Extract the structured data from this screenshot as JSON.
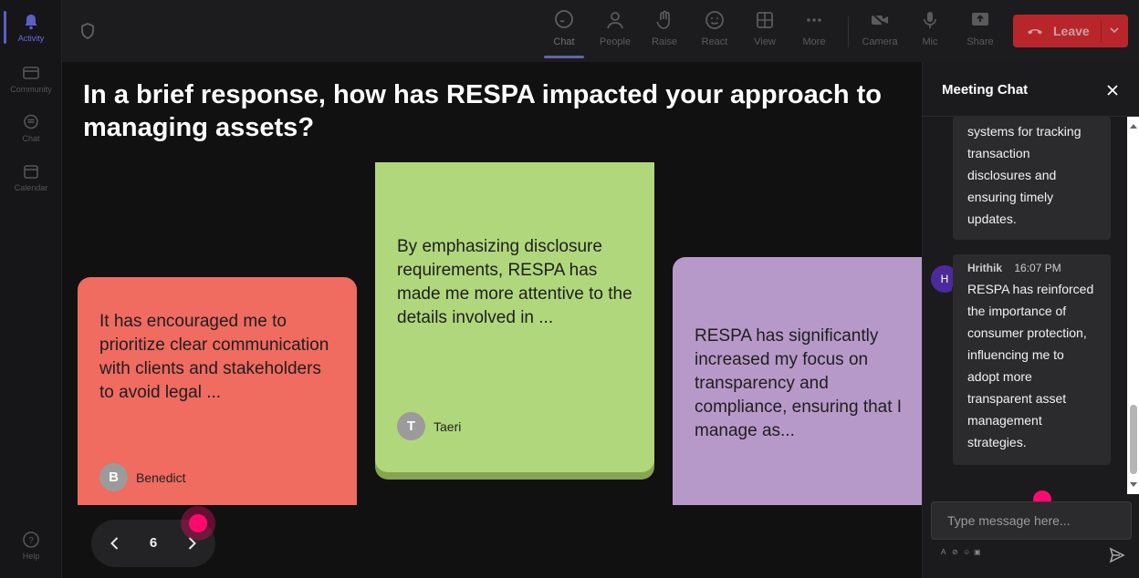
{
  "rail": {
    "items": [
      {
        "label": "Activity",
        "icon": "bell-icon",
        "active": true
      },
      {
        "label": "Community",
        "icon": "community-icon",
        "active": false
      },
      {
        "label": "Chat",
        "icon": "chat-icon",
        "active": false
      },
      {
        "label": "Calendar",
        "icon": "calendar-icon",
        "active": false
      }
    ],
    "help_label": "Help"
  },
  "toolbar": {
    "chat_label": "Chat",
    "people_label": "People",
    "raise_label": "Raise",
    "react_label": "React",
    "view_label": "View",
    "more_label": "More",
    "camera_label": "Camera",
    "mic_label": "Mic",
    "share_label": "Share",
    "leave_label": "Leave"
  },
  "stage": {
    "question": "In a brief response, how has RESPA impacted your approach to managing assets?",
    "cards": [
      {
        "text": "It has encouraged me to prioritize clear communication with clients and stakeholders to avoid legal ...",
        "author": "Benedict",
        "initial": "B",
        "color": "#f06b60"
      },
      {
        "text": "By emphasizing disclosure requirements, RESPA has made me more attentive to the details involved in ...",
        "author": "Taeri",
        "initial": "T",
        "color": "#b1d77d"
      },
      {
        "text": "RESPA has significantly increased my focus on transparency and compliance, ensuring that I manage as...",
        "color": "#b799c9"
      }
    ],
    "pager": {
      "page": "6"
    }
  },
  "chat": {
    "title": "Meeting Chat",
    "messages": [
      {
        "text": "systems for tracking transaction disclosures and ensuring timely updates."
      },
      {
        "sender": "Hrithik",
        "initial": "H",
        "time": "16:07 PM",
        "text": "RESPA has reinforced the importance of consumer protection, influencing me to adopt more transparent asset management strategies."
      }
    ],
    "input_placeholder": "Type message here..."
  },
  "colors": {
    "leave": "#b8262b",
    "accent": "#5b5fc7",
    "cursor": "#ff0a6c"
  }
}
